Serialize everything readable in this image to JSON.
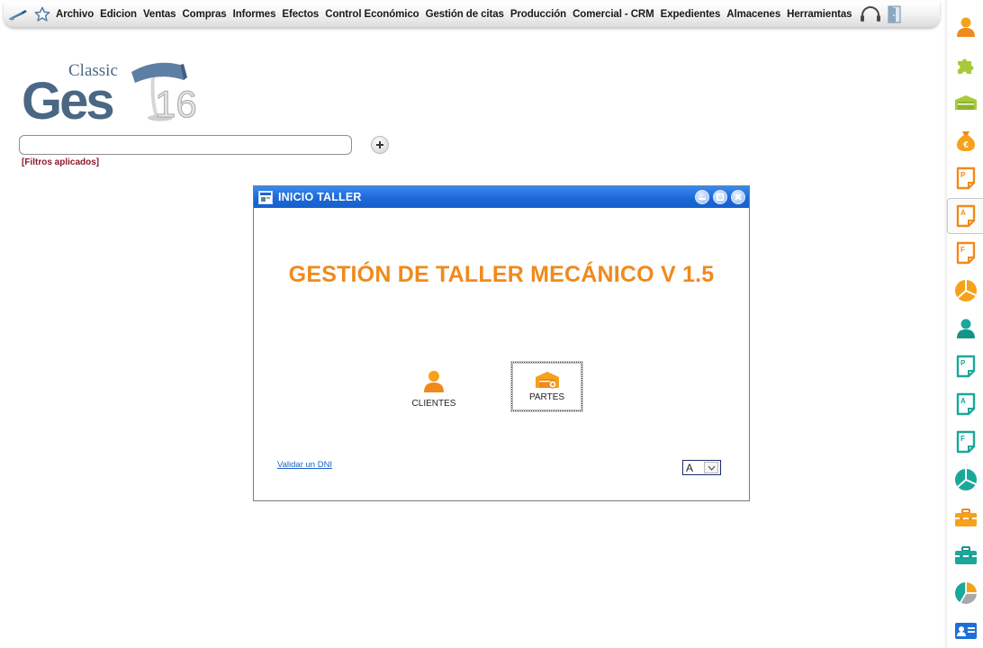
{
  "menu": {
    "items": [
      "Archivo",
      "Edicion",
      "Ventas",
      "Compras",
      "Informes",
      "Efectos",
      "Control Económico",
      "Gestión de citas",
      "Producción",
      "Comercial - CRM",
      "Expedientes",
      "Almacenes",
      "Herramientas"
    ]
  },
  "logo": {
    "top_word": "Classic",
    "main_word": "Ges",
    "version": "16"
  },
  "search": {
    "value": "",
    "placeholder": "",
    "filters_label": "[Filtros aplicados]"
  },
  "dialog": {
    "title": "INICIO TALLER",
    "heading": "GESTIÓN DE TALLER MECÁNICO V 1.5",
    "tiles": [
      {
        "label": "CLIENTES",
        "icon": "user-icon"
      },
      {
        "label": "PARTES",
        "icon": "workshop-icon"
      }
    ],
    "link_label": "Validar un DNI",
    "font_select_value": "A"
  },
  "sidebar": {
    "icons": [
      "person-icon",
      "puzzle-icon",
      "truck-icon",
      "money-bag-icon",
      "doc-p-icon",
      "doc-a-icon",
      "doc-f-icon",
      "pie-chart-icon",
      "person-icon",
      "doc-p-icon",
      "doc-a-icon",
      "doc-f-icon",
      "pie-chart-icon",
      "toolbox-icon",
      "toolbox-icon",
      "pie-chart-icon",
      "contact-card-icon"
    ],
    "letters": {
      "p": "P",
      "a": "A",
      "f": "F"
    }
  },
  "colors": {
    "accent_orange": "#f08a1c",
    "title_blue": "#1c68d8",
    "accent_teal": "#1aa89a",
    "filter_red": "#8b1a2a"
  }
}
